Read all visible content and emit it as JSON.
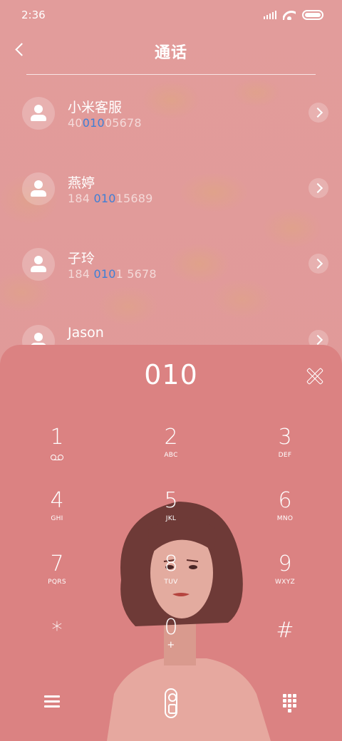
{
  "status_bar": {
    "time": "2:36"
  },
  "header": {
    "title": "通话"
  },
  "contacts": [
    {
      "name": "小米客服",
      "number_pre": "40",
      "number_match": "010",
      "number_post": "05678"
    },
    {
      "name": "燕婷",
      "number_pre": "184 ",
      "number_match": "010",
      "number_post": "15689"
    },
    {
      "name": "子玲",
      "number_pre": "184 ",
      "number_match": "010",
      "number_post": "1 5678"
    },
    {
      "name": "Jason",
      "number_pre": "",
      "number_match": "",
      "number_post": ""
    }
  ],
  "dialer": {
    "input": "010",
    "keys": [
      {
        "digit": "1",
        "letters": ""
      },
      {
        "digit": "2",
        "letters": "ABC"
      },
      {
        "digit": "3",
        "letters": "DEF"
      },
      {
        "digit": "4",
        "letters": "GHI"
      },
      {
        "digit": "5",
        "letters": "JKL"
      },
      {
        "digit": "6",
        "letters": "MNO"
      },
      {
        "digit": "7",
        "letters": "PQRS"
      },
      {
        "digit": "8",
        "letters": "TUV"
      },
      {
        "digit": "9",
        "letters": "WXYZ"
      },
      {
        "digit": "*",
        "letters": ""
      },
      {
        "digit": "0",
        "letters": "+"
      },
      {
        "digit": "#",
        "letters": ""
      }
    ]
  },
  "icons": {
    "back": "back-arrow-icon",
    "clear": "clear-x-icon",
    "menu": "menu-icon",
    "call": "phone-call-icon",
    "keypad": "keypad-icon"
  },
  "colors": {
    "match_highlight": "#3e7fd6",
    "background": "#e19a98",
    "dialer_panel": "#db8282"
  }
}
